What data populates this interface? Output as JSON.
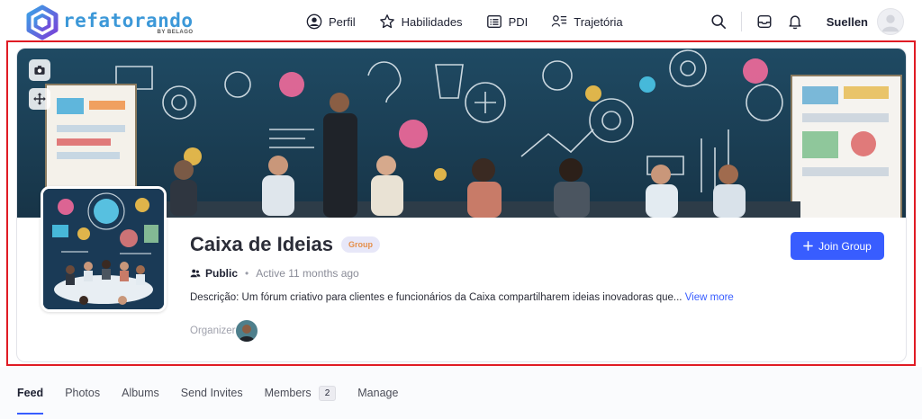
{
  "brand": {
    "name": "refatorando",
    "sub": "BY BELAGO"
  },
  "nav": [
    {
      "label": "Perfil",
      "icon": "user-circle-icon"
    },
    {
      "label": "Habilidades",
      "icon": "star-icon"
    },
    {
      "label": "PDI",
      "icon": "list-icon"
    },
    {
      "label": "Trajetória",
      "icon": "trajectory-icon"
    }
  ],
  "header": {
    "user_name": "Suellen"
  },
  "group": {
    "title": "Caixa de Ideias",
    "badge": "Group",
    "privacy": "Public",
    "separator": "•",
    "active": "Active 11 months ago",
    "description": "Descrição: Um fórum criativo para clientes e funcionários da Caixa compartilharem ideias inovadoras que...",
    "view_more": "View more",
    "organizer_label": "Organizer",
    "join_label": "Join Group"
  },
  "tabs": [
    {
      "label": "Feed"
    },
    {
      "label": "Photos"
    },
    {
      "label": "Albums"
    },
    {
      "label": "Send Invites"
    },
    {
      "label": "Members",
      "count": "2"
    },
    {
      "label": "Manage"
    }
  ],
  "colors": {
    "accent": "#385dff",
    "brand": "#3c98d8",
    "highlight": "#e01b24",
    "badge_text": "#e58f4a"
  }
}
